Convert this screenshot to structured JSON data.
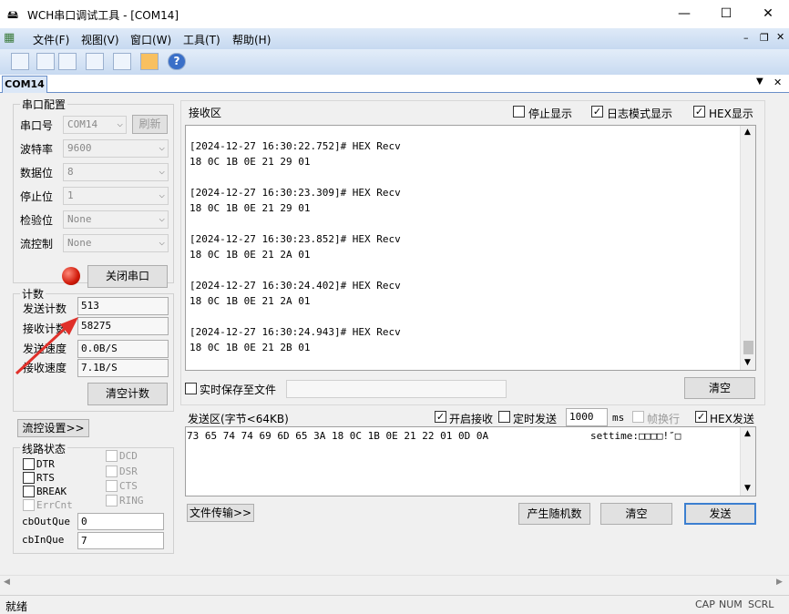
{
  "window": {
    "title": "WCH串口调试工具 - [COM14]",
    "minimize": "—",
    "maximize": "☐",
    "close": "✕"
  },
  "menu": [
    "文件(F)",
    "视图(V)",
    "窗口(W)",
    "工具(T)",
    "帮助(H)"
  ],
  "tab": {
    "label": "COM14"
  },
  "serial_config": {
    "title": "串口配置",
    "port_label": "串口号",
    "port_value": "COM14",
    "refresh": "刷新",
    "baud_label": "波特率",
    "baud_value": "9600",
    "databits_label": "数据位",
    "databits_value": "8",
    "stopbits_label": "停止位",
    "stopbits_value": "1",
    "parity_label": "检验位",
    "parity_value": "None",
    "flow_label": "流控制",
    "flow_value": "None",
    "close_port": "关闭串口"
  },
  "counters": {
    "title": "计数",
    "send_label": "发送计数",
    "send_value": "513",
    "recv_label": "接收计数",
    "recv_value": "58275",
    "send_speed_label": "发送速度",
    "send_speed_value": "0.0B/S",
    "recv_speed_label": "接收速度",
    "recv_speed_value": "7.1B/S",
    "clear": "清空计数"
  },
  "flow_settings": "流控设置>>",
  "line_status": {
    "title": "线路状态",
    "left": [
      "DTR",
      "RTS",
      "BREAK",
      "ErrCnt"
    ],
    "right": [
      "DCD",
      "DSR",
      "CTS",
      "RING"
    ],
    "cbOutQue_label": "cbOutQue",
    "cbOutQue_value": "0",
    "cbInQue_label": "cbInQue",
    "cbInQue_value": "7"
  },
  "receive": {
    "title": "接收区",
    "stop_display": "停止显示",
    "log_mode": "日志模式显示",
    "hex_display": "HEX显示",
    "lines": [
      "[2024-12-27 16:30:22.752]# HEX Recv",
      "18 0C 1B 0E 21 29 01",
      "",
      "[2024-12-27 16:30:23.309]# HEX Recv",
      "18 0C 1B 0E 21 29 01",
      "",
      "[2024-12-27 16:30:23.852]# HEX Recv",
      "18 0C 1B 0E 21 2A 01",
      "",
      "[2024-12-27 16:30:24.402]# HEX Recv",
      "18 0C 1B 0E 21 2A 01",
      "",
      "[2024-12-27 16:30:24.943]# HEX Recv",
      "18 0C 1B 0E 21 2B 01"
    ],
    "save_realtime": "实时保存至文件",
    "clear": "清空"
  },
  "send": {
    "title": "发送区(字节<64KB)",
    "enable_recv": "开启接收",
    "timed_send": "定时发送",
    "interval": "1000",
    "ms": "ms",
    "line_feed": "帧换行",
    "hex_send": "HEX发送",
    "content": "73 65 74 74 69 6D 65 3A 18 0C 1B 0E 21 22 01 0D 0A",
    "ascii": "settime:□□□□!″□",
    "file_transfer": "文件传输>>",
    "random": "产生随机数",
    "clear": "清空",
    "send_btn": "发送"
  },
  "status": {
    "ready": "就绪",
    "cap": "CAP",
    "num": "NUM",
    "scrl": "SCRL"
  }
}
